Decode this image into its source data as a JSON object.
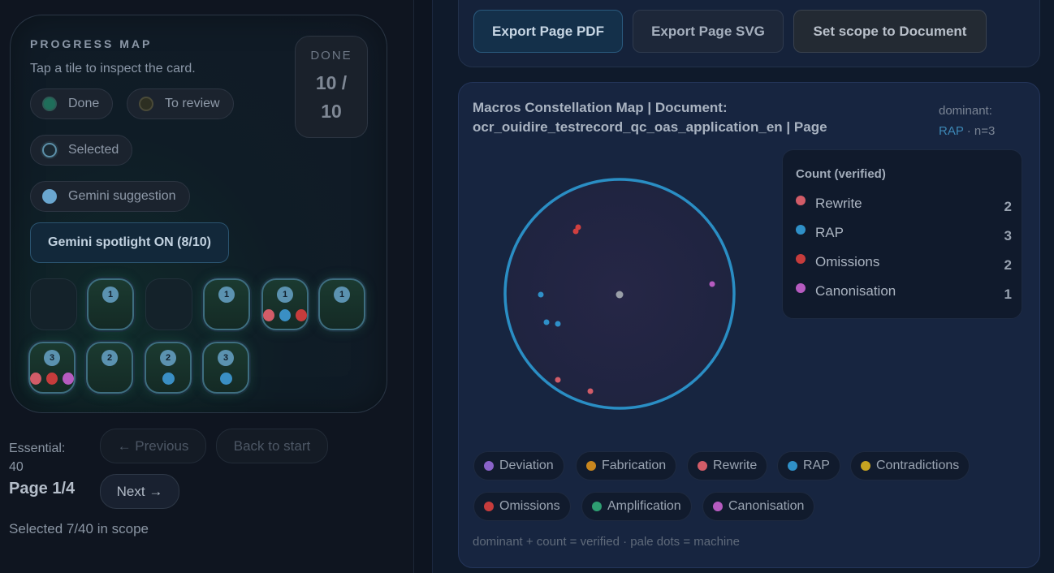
{
  "progress_map": {
    "title": "PROGRESS MAP",
    "subtitle": "Tap a tile to inspect the card.",
    "done_label": "DONE",
    "done_count": "10 /",
    "done_total": "10",
    "legend": [
      {
        "label": "Done",
        "color": "#1f6e5a"
      },
      {
        "label": "To review",
        "color": "#2d2f22"
      },
      {
        "label": "Selected",
        "color": "#1b2a34"
      },
      {
        "label": "Gemini suggestion",
        "color": "#6aa6cf"
      }
    ],
    "spotlight_label": "Gemini spotlight ON (8/10)",
    "tiles": [
      {
        "state": "pending",
        "badge": "",
        "dots": []
      },
      {
        "state": "done",
        "badge": "1",
        "dots": []
      },
      {
        "state": "pending",
        "badge": "",
        "dots": []
      },
      {
        "state": "done",
        "badge": "1",
        "dots": []
      },
      {
        "state": "done",
        "badge": "1",
        "dots": [
          "#d25c68",
          "#3a8fc4",
          "#c63c3c"
        ]
      },
      {
        "state": "done",
        "badge": "1",
        "dots": []
      },
      {
        "state": "done",
        "badge": "3",
        "dots": [
          "#d25c68",
          "#c63c3c",
          "#b65bc0"
        ]
      },
      {
        "state": "done",
        "badge": "2",
        "dots": []
      },
      {
        "state": "done",
        "badge": "2",
        "dots": [
          "#3a8fc4"
        ]
      },
      {
        "state": "done",
        "badge": "3",
        "dots": [
          "#3a8fc4"
        ]
      }
    ]
  },
  "nav": {
    "essential_label": "Essential:",
    "essential_value": "40",
    "page_label": "Page 1/4",
    "previous_label": "← Previous",
    "back_label": "Back to start",
    "next_label": "Next →",
    "selected_text": "Selected 7/40 in scope"
  },
  "toolbar": {
    "export_pdf": "Export Page PDF",
    "export_svg": "Export Page SVG",
    "set_scope": "Set scope to Document"
  },
  "map": {
    "title_line1": "Macros Constellation Map | Document:",
    "title_line2": "ocr_ouidire_testrecord_qc_oas_application_en | Page",
    "dominant_label": "dominant:",
    "dominant_value": "RAP",
    "dominant_n": " · n=3",
    "count_title": "Count (verified)",
    "counts": [
      {
        "name": "Rewrite",
        "value": "2",
        "color": "#d25c68"
      },
      {
        "name": "RAP",
        "value": "3",
        "color": "#2f90c8"
      },
      {
        "name": "Omissions",
        "value": "2",
        "color": "#c63c3c"
      },
      {
        "name": "Canonisation",
        "value": "1",
        "color": "#b65bc0"
      }
    ],
    "legend": [
      {
        "name": "Deviation",
        "color": "#8a63c9"
      },
      {
        "name": "Fabrication",
        "color": "#c8861e"
      },
      {
        "name": "Rewrite",
        "color": "#d25c68"
      },
      {
        "name": "RAP",
        "color": "#2f90c8"
      },
      {
        "name": "Contradictions",
        "color": "#c6a321"
      },
      {
        "name": "Omissions",
        "color": "#c63c3c"
      },
      {
        "name": "Amplification",
        "color": "#2e9e72"
      },
      {
        "name": "Canonisation",
        "color": "#b65bc0"
      }
    ],
    "footnote": "dominant + count = verified · pale dots = machine"
  }
}
